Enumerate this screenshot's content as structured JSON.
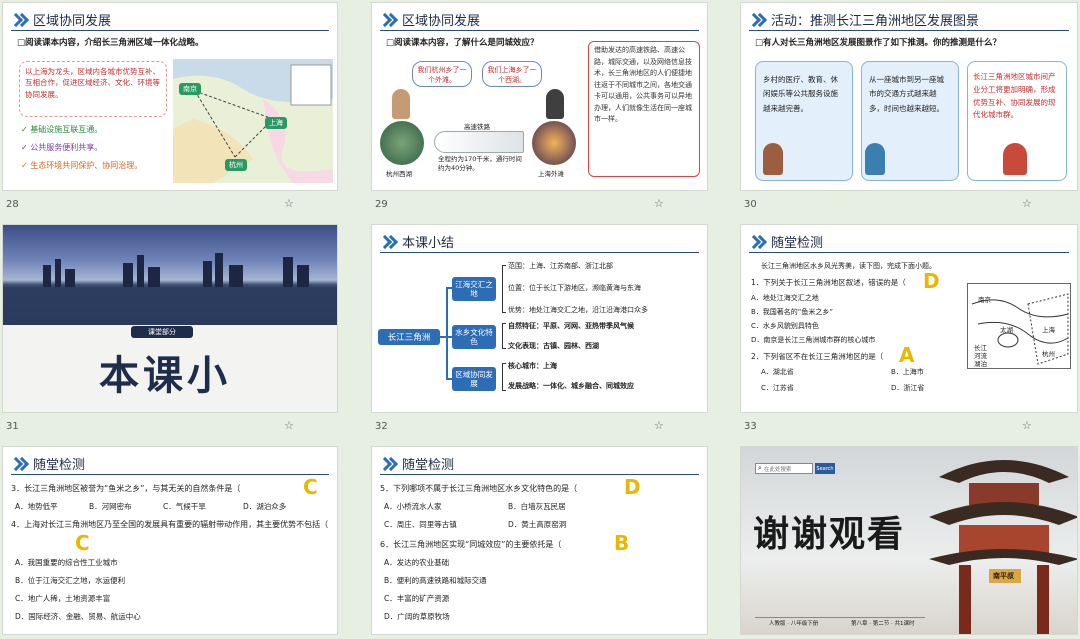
{
  "slides": [
    {
      "num": "28",
      "title": "区域协同发展",
      "prompt": "阅读课本内容，介绍长三角洲区域一体化战略。",
      "prompt_highlight": "区域一体化战略",
      "desc": "以上海为龙头，区域内各城市优势互补、互相合作，促进区域经济、文化、环境等协同发展。",
      "bullets": [
        "基础设施互联互通。",
        "公共服务便利共享。",
        "生态环境共同保护、协同治理。"
      ],
      "cities": [
        "南京",
        "上海",
        "杭州"
      ]
    },
    {
      "num": "29",
      "title": "区域协同发展",
      "prompt": "阅读课本内容，了解什么是同城效应？",
      "bubble1": "我们杭州乡了一个外滩。",
      "bubble2": "我们上海乡了一个西湖。",
      "train_label": "高速铁路",
      "train_note": "全程约为170千米，通行时间约为40分钟。",
      "left_caption": "杭州西湖",
      "right_caption": "上海外滩",
      "side_text": "借助发达的高速铁路、高速公路，城际交通，以及网络信息技术，长三角洲地区的人们便捷地往返于不同城市之间，各地交通卡可以通用，公共事务可以异地办理，人们就像生活在同一座城市一样。"
    },
    {
      "num": "30",
      "title": "活动：推测长江三角洲地区发展图景",
      "prompt": "有人对长三角洲地区发展图景作了如下推测。你的推测是什么？",
      "cards": [
        "乡村的医疗、教育、休闲娱乐等公共服务设施越来越完善。",
        "从一座城市到另一座城市的交通方式越来越多，时间也越来越短。",
        "长江三角洲地区城市间产业分工将更加明确，形成优势互补、协同发展的现代化城市群。"
      ]
    },
    {
      "num": "31",
      "tag": "课堂部分",
      "title": "本课小结"
    },
    {
      "num": "32",
      "title": "本课小结",
      "root": "长江三角洲",
      "branches": [
        {
          "label": "江海交汇之地",
          "items": [
            "范围：上海、江苏南部、浙江北部",
            "位置：位于长江下游地区，濒临黄海与东海",
            "优势：地处江海交汇之地，沿江沿海港口众多"
          ]
        },
        {
          "label": "水乡文化特色",
          "items": [
            "自然特征：平原、河网、亚热带季风气候",
            "文化表现：古镇、园林、西湖"
          ]
        },
        {
          "label": "区域协同发展",
          "items": [
            "核心城市：上海",
            "发展战略：一体化、城乡融合、同城效应"
          ]
        }
      ]
    },
    {
      "num": "33",
      "title": "随堂检测",
      "intro": "长江三角洲地区水乡风光秀美，读下图，完成下面小题。",
      "q1": "1．下列关于长江三角洲地区叙述，错误的是（",
      "q1_ans": "D",
      "q1_opts": [
        "A．地处江海交汇之地",
        "B．我国著名的“鱼米之乡”",
        "C．水乡风貌别具特色",
        "D．南京是长江三角洲城市群的核心城市"
      ],
      "q2": "2．下列省区不在长江三角洲地区的是（",
      "q2_ans": "A",
      "q2_opts": [
        "A．湖北省",
        "B．上海市",
        "C．江苏省",
        "D．浙江省"
      ],
      "map_labels": [
        "南京",
        "太湖",
        "上海",
        "杭州",
        "长江",
        "河流",
        "湖泊"
      ]
    },
    {
      "num": "34",
      "title": "随堂检测",
      "q3": "3．长江三角洲地区被誉为“鱼米之乡”，与其无关的自然条件是（",
      "q3_ans": "C",
      "q3_opts": [
        "A．地势低平",
        "B．河网密布",
        "C．气候干旱",
        "D．湖泊众多"
      ],
      "q4": "4．上海对长江三角洲地区乃至全国的发展具有重要的辐射带动作用，其主要优势不包括（",
      "q4_ans": "C",
      "q4_opts": [
        "A．我国重要的综合性工业城市",
        "B．位于江海交汇之地，水运便利",
        "C．地广人稀，土地资源丰富",
        "D．国际经济、金融、贸易、航运中心"
      ]
    },
    {
      "num": "35",
      "title": "随堂检测",
      "q5": "5．下列哪项不属于长江三角洲地区水乡文化特色的是（",
      "q5_ans": "D",
      "q5_opts_l": [
        "A．小桥流水人家",
        "C．周庄、同里等古镇"
      ],
      "q5_opts_r": [
        "B．白墙灰瓦民居",
        "D．黄土高原窑洞"
      ],
      "q6": "6．长江三角洲地区实现“同城效应”的主要依托是（",
      "q6_ans": "B",
      "q6_opts": [
        "A．发达的农业基础",
        "B．便利的高速铁路和城际交通",
        "C．丰富的矿产资源",
        "D．广阔的草原牧场"
      ]
    },
    {
      "num": "36",
      "title": "谢谢观看",
      "search_placeholder": "在此处搜索",
      "search_btn": "Search",
      "gate_text": "南平叔",
      "footer_left": "人教版 · 八年级下册",
      "footer_right": "第八章 · 第二节 · 共1课时"
    }
  ]
}
